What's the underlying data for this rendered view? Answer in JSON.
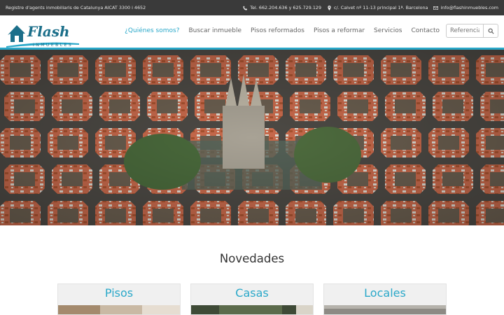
{
  "topbar": {
    "registry": "Registre d'agents inmobiliaris de Catalunya AICAT 3300 i 4652",
    "phone": "Tel. 662.204.636 y 625.729.129",
    "address": "c/. Calvet nº 11-13 principal 1ª. Barcelona",
    "email": "info@flashinmuebles.com"
  },
  "brand": {
    "name": "Flash",
    "sub": "INMUEBLES",
    "color": "#2aa8c9"
  },
  "nav": {
    "items": [
      {
        "label": "¿Quiénes somos?",
        "active": true
      },
      {
        "label": "Buscar inmueble",
        "active": false
      },
      {
        "label": "Pisos reformados",
        "active": false
      },
      {
        "label": "Pisos a reformar",
        "active": false
      },
      {
        "label": "Servicios",
        "active": false
      },
      {
        "label": "Contacto",
        "active": false
      }
    ],
    "search_placeholder": "Referencia"
  },
  "section_title": "Novedades",
  "cards": [
    {
      "label": "Pisos"
    },
    {
      "label": "Casas"
    },
    {
      "label": "Locales"
    }
  ]
}
